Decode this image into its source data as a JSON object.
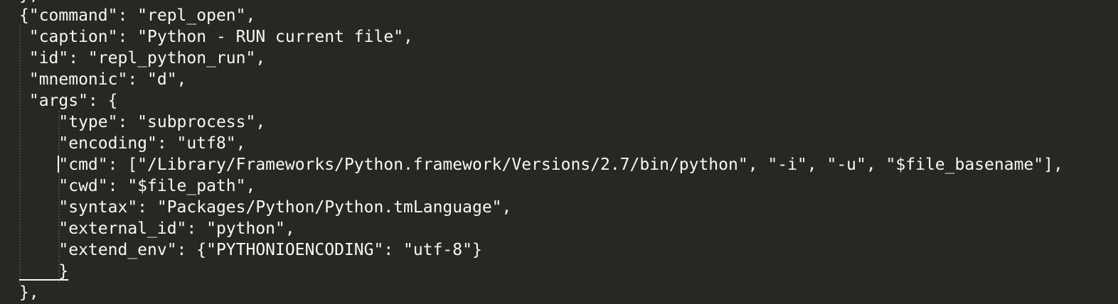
{
  "editor": {
    "theme": "Monokai",
    "colors": {
      "background": "#272822",
      "text": "#f8f8f2",
      "indent_guide": "#48483e"
    },
    "top_fragment": "},",
    "lines": [
      "{\"command\": \"repl_open\",",
      " \"caption\": \"Python - RUN current file\",",
      " \"id\": \"repl_python_run\",",
      " \"mnemonic\": \"d\",",
      " \"args\": {",
      "    \"type\": \"subprocess\",",
      "    \"encoding\": \"utf8\",",
      "    \"cmd\": [\"/Library/Frameworks/Python.framework/Versions/2.7/bin/python\", \"-i\", \"-u\", \"$file_basename\"],",
      "    \"cwd\": \"$file_path\",",
      "    \"syntax\": \"Packages/Python/Python.tmLanguage\",",
      "    \"external_id\": \"python\",",
      "    \"extend_env\": {\"PYTHONIOENCODING\": \"utf-8\"}",
      "    }",
      "},"
    ]
  }
}
